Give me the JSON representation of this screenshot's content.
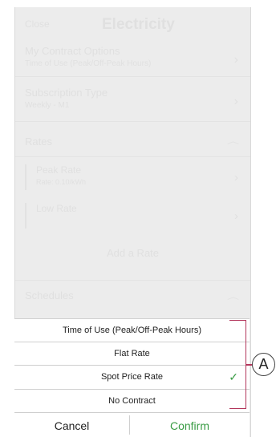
{
  "header": {
    "close_label": "Close",
    "title": "Electricity"
  },
  "contract_options": {
    "title": "My Contract Options",
    "value": "Time of Use (Peak/Off-Peak Hours)"
  },
  "subscription": {
    "title": "Subscription Type",
    "value": "Weekly - M1"
  },
  "rates": {
    "section_label": "Rates",
    "items": [
      {
        "title": "Peak Rate",
        "value": "Rate: 0.10/kWh"
      },
      {
        "title": "Low Rate",
        "value": ""
      }
    ],
    "add_label": "Add a Rate"
  },
  "schedules": {
    "section_label": "Schedules"
  },
  "sheet": {
    "options": [
      {
        "label": "Time of Use (Peak/Off-Peak Hours)",
        "selected": false
      },
      {
        "label": "Flat Rate",
        "selected": false
      },
      {
        "label": "Spot Price Rate",
        "selected": true
      },
      {
        "label": "No Contract",
        "selected": false
      }
    ],
    "cancel_label": "Cancel",
    "confirm_label": "Confirm"
  },
  "annotation": {
    "label": "A"
  },
  "colors": {
    "accent_green": "#3a9c45",
    "bracket": "#b3365b"
  },
  "icons": {
    "chevron": "chevron-right-icon",
    "check": "check-icon",
    "caret": "caret-up-icon"
  }
}
